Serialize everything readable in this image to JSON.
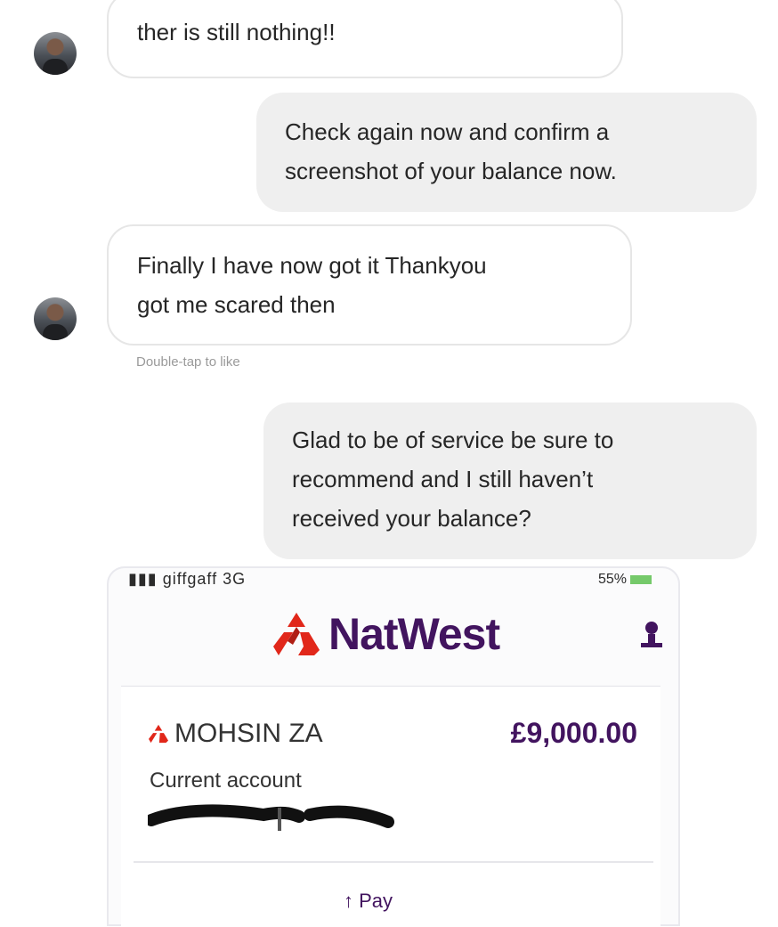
{
  "messages": [
    {
      "side": "in",
      "lines": [
        "ther is still nothing!!"
      ]
    },
    {
      "side": "out",
      "lines": [
        "Check again now and confirm a",
        "screenshot of your balance now."
      ]
    },
    {
      "side": "in",
      "lines": [
        "Finally I have now got it Thankyou",
        "got me scared then"
      ]
    },
    {
      "side": "out",
      "lines": [
        "Glad to be of service be sure to",
        "recommend and I still haven’t",
        "received your balance?"
      ]
    }
  ],
  "like_hint": "Double-tap to like",
  "phone": {
    "carrier": "giffgaff 3G",
    "battery": "55%",
    "bank_name": "NatWest",
    "account_name": "MOHSIN ZA",
    "balance": "£9,000.00",
    "account_type": "Current account",
    "pay_label": "Pay",
    "brand_color": "#42145f",
    "logo_color": "#e1271a"
  },
  "icons": [
    "natwest-logo-icon",
    "profile-icon",
    "up-arrow-icon"
  ]
}
